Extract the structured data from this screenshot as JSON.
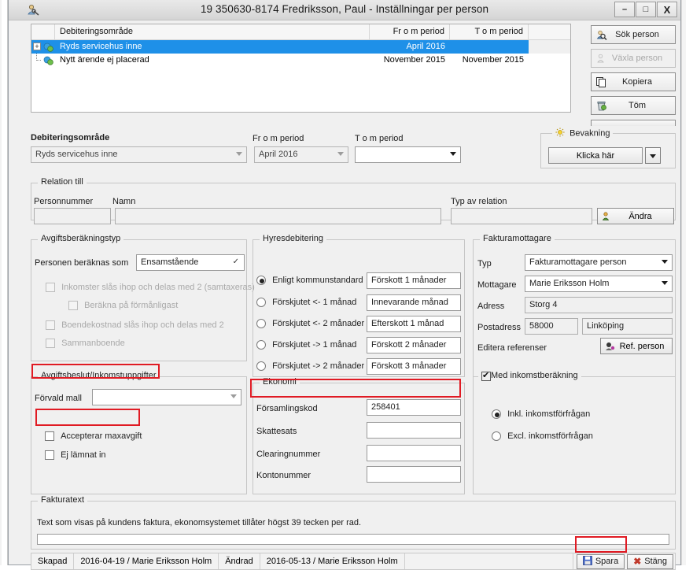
{
  "window": {
    "title": "19 350630-8174 Fredriksson, Paul  -  Inställningar per person",
    "icon": "person-settings-icon",
    "minimize": "–",
    "maximize": "□",
    "close": "X"
  },
  "grid": {
    "columns": [
      "Debiteringsområde",
      "Fr o m period",
      "T o m period"
    ],
    "rows": [
      {
        "expander": "+",
        "name": "Ryds servicehus inne",
        "from": "April 2016",
        "to": "",
        "selected": true
      },
      {
        "expander": "",
        "name": "Nytt ärende ej placerad",
        "from": "November 2015",
        "to": "November 2015",
        "selected": false
      }
    ]
  },
  "side_buttons": [
    {
      "label": "Sök person",
      "icon": "search-person-icon",
      "disabled": false
    },
    {
      "label": "Växla person",
      "icon": "switch-person-icon",
      "disabled": true
    },
    {
      "label": "Kopiera",
      "icon": "copy-icon",
      "disabled": false
    },
    {
      "label": "Töm",
      "icon": "trash-icon",
      "disabled": false
    }
  ],
  "area": {
    "debiteringsomrade_label": "Debiteringsområde",
    "debiteringsomrade_value": "Ryds servicehus inne",
    "from_label": "Fr o m period",
    "from_value": "April 2016",
    "to_label": "T o m period",
    "to_value": ""
  },
  "bevakning": {
    "title": "Bevakning",
    "icon": "sun-alert-icon",
    "button_label": "Klicka här",
    "dropdown_icon": "chevron-down-icon"
  },
  "relation": {
    "group_title": "Relation till",
    "personnummer_label": "Personnummer",
    "personnummer_value": "",
    "namn_label": "Namn",
    "namn_value": "",
    "typ_label": "Typ av relation",
    "typ_value": "",
    "andra_button": "Ändra",
    "andra_icon": "edit-person-icon"
  },
  "avgiftsberakning": {
    "group_title": "Avgiftsberäkningstyp",
    "person_label": "Personen beräknas som",
    "person_value": "Ensamstående",
    "checkboxes": [
      {
        "label": "Inkomster slås ihop och delas med 2 (samtaxeras)",
        "checked": false,
        "disabled": true,
        "indent": 0
      },
      {
        "label": "Beräkna på förmånligast",
        "checked": false,
        "disabled": true,
        "indent": 1
      },
      {
        "label": "Boendekostnad slås ihop och delas med 2",
        "checked": false,
        "disabled": true,
        "indent": 0
      },
      {
        "label": "Sammanboende",
        "checked": false,
        "disabled": true,
        "indent": 0
      }
    ]
  },
  "hyresdebitering": {
    "group_title": "Hyresdebitering",
    "rows": [
      {
        "radio": "Enligt kommunstandard",
        "selected": true,
        "value": "Förskott 1 månader"
      },
      {
        "radio": "Förskjutet <- 1 månad",
        "selected": false,
        "value": "Innevarande månad"
      },
      {
        "radio": "Förskjutet <- 2 månader",
        "selected": false,
        "value": "Efterskott 1 månad"
      },
      {
        "radio": "Förskjutet -> 1 månad",
        "selected": false,
        "value": "Förskott 2 månader"
      },
      {
        "radio": "Förskjutet -> 2 månader",
        "selected": false,
        "value": "Förskott 3 månader"
      }
    ]
  },
  "fakturamottagare": {
    "group_title": "Fakturamottagare",
    "typ_label": "Typ",
    "typ_value": "Fakturamottagare person",
    "mottagare_label": "Mottagare",
    "mottagare_value": "Marie Eriksson Holm",
    "adress_label": "Adress",
    "adress_value": "Storg 4",
    "postadress_label": "Postadress",
    "postnummer_value": "58000",
    "postort_value": "Linköping",
    "referens_label": "Editera referenser",
    "ref_button": "Ref. person",
    "ref_icon": "ref-person-icon"
  },
  "avgiftsbeslut": {
    "group_title": "Avgiftsbeslut/Inkomstuppgifter",
    "mall_label": "Förvald mall",
    "mall_value": "",
    "checkboxes": [
      {
        "label": "Accepterar maxavgift",
        "checked": false
      },
      {
        "label": "Ej lämnat in",
        "checked": false
      }
    ]
  },
  "ekonomi": {
    "group_title": "Ekonomi",
    "fields": [
      {
        "label": "Församlingskod",
        "value": "258401",
        "highlighted": true
      },
      {
        "label": "Skattesats",
        "value": "",
        "highlighted": false
      },
      {
        "label": "Clearingnummer",
        "value": "",
        "highlighted": false
      },
      {
        "label": "Kontonummer",
        "value": "",
        "highlighted": false
      }
    ]
  },
  "inkomstberakning": {
    "group_title": "Med inkomstberäkning",
    "checked": true,
    "radios": [
      {
        "label": "Inkl. inkomstförfrågan",
        "selected": true
      },
      {
        "label": "Excl. inkomstförfrågan",
        "selected": false
      }
    ]
  },
  "fakturatext": {
    "group_title": "Fakturatext",
    "hint": "Text som visas på kundens faktura, ekonomsystemet tillåter högst 39 tecken per rad.",
    "value": ""
  },
  "statusbar": {
    "skapad_label": "Skapad",
    "skapad_value": "2016-04-19 / Marie Eriksson Holm",
    "andrad_label": "Ändrad",
    "andrad_value": "2016-05-13 / Marie Eriksson Holm",
    "spara_label": "Spara",
    "spara_icon": "save-icon",
    "stang_label": "Stäng",
    "stang_icon": "close-x-icon"
  },
  "annotations": {
    "color": "#e01b24",
    "boxes": [
      "avgiftsbeslut-title",
      "accepterar-maxavgift",
      "forsamlingskod",
      "spara-button"
    ]
  }
}
